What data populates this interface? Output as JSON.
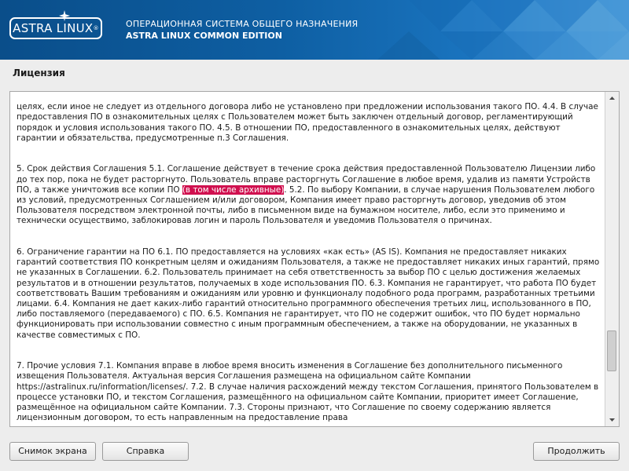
{
  "header": {
    "logo_text": "ASTRA LINUX",
    "trademark": "®",
    "title_line1": "ОПЕРАЦИОННАЯ СИСТЕМА ОБЩЕГО НАЗНАЧЕНИЯ",
    "title_line2": "ASTRA LINUX COMMON EDITION"
  },
  "section": {
    "title": "Лицензия"
  },
  "license": {
    "p1": "целях, если иное не следует из отдельного договора либо не установлено при предложении использования такого ПО. 4.4. В случае предоставления ПО в ознакомительных целях с Пользователем может быть заключен отдельный договор, регламентирующий порядок и условия использования такого ПО. 4.5. В отношении ПО, предоставленного в ознакомительных целях, действуют гарантии и обязательства, предусмотренные п.3 Соглашения.",
    "p2_before": "5. Срок действия Соглашения  5.1. Соглашение действует в течение срока действия предоставленной Пользователю Лицензии либо до тех пор, пока не будет расторгнуто. Пользователь вправе расторгнуть Соглашение в любое время, удалив из памяти Устройств ПО, а также уничтожив все копии ПО ",
    "p2_highlight": "(в том числе архивные)",
    "p2_after": ". 5.2. По выбору Компании, в случае нарушения Пользователем любого из условий, предусмотренных Соглашением и/или договором, Компания имеет право расторгнуть договор, уведомив об этом Пользователя посредством электронной почты, либо в письменном виде на бумажном носителе, либо, если это применимо и технически осуществимо, заблокировав логин и пароль Пользователя и уведомив Пользователя о причинах.",
    "p3": "6. Ограничение гарантии на ПО 6.1. ПО предоставляется на условиях «как есть» (AS IS). Компания не предоставляет никаких гарантий соответствия ПО конкретным целям и ожиданиям Пользователя, а также не предоставляет никаких иных гарантий, прямо не указанных в Соглашении. 6.2. Пользователь принимает на себя ответственность за выбор ПО с целью достижения желаемых результатов и в отношении результатов, получаемых в ходе использования ПО. 6.3. Компания не гарантирует, что работа ПО будет соответствовать Вашим требованиям и ожиданиям или уровню и функционалу подобного рода программ, разработанных третьими лицами. 6.4. Компания не дает каких-либо гарантий относительно программного обеспечения третьих лиц, использованного в ПО, либо поставляемого (передаваемого) с ПО. 6.5. Компания не гарантирует, что ПО не содержит ошибок, что ПО будет нормально функционировать при использовании совместно с иным программным обеспечением, а также на оборудовании, не указанных в качестве совместимых с ПО.",
    "p4": "7. Прочие условия 7.1. Компания вправе в любое время вносить изменения в Соглашение без дополнительного письменного извещения Пользователя. Актуальная версия Соглашения размещена на официальном сайте Компании https://astralinux.ru/information/licenses/. 7.2. В случае наличия расхождений между текстом Соглашения, принятого Пользователем в процессе установки ПО, и текстом Соглашения, размещённого на официальном сайте Компании, приоритет имеет Соглашение, размещённое на официальном сайте Компании. 7.3. Стороны признают, что Соглашение по своему содержанию является лицензионным договором, то есть направленным на предоставление права"
  },
  "buttons": {
    "screenshot": "Снимок экрана",
    "help": "Справка",
    "continue": "Продолжить"
  },
  "colors": {
    "header_dark": "#0a4e8a",
    "header_light": "#3d8fd1",
    "highlight": "#d0104f",
    "background": "#ededed"
  }
}
